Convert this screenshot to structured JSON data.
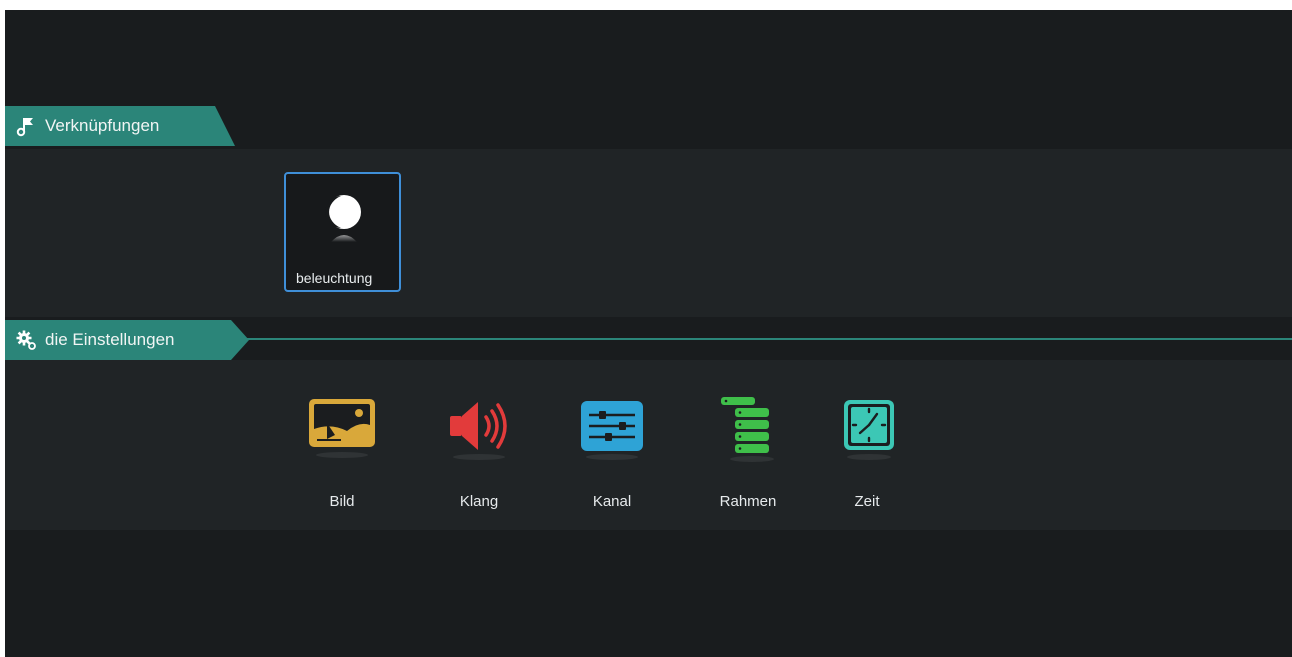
{
  "sections": {
    "shortcuts": {
      "title": "Verknüpfungen",
      "icon": "flag-music-icon"
    },
    "settings": {
      "title": "die Einstellungen",
      "icon": "gears-icon"
    }
  },
  "shortcuts": [
    {
      "label": "beleuchtung",
      "icon": "moon-icon"
    }
  ],
  "settings_items": [
    {
      "label": "Bild",
      "icon": "picture-icon",
      "color": "#d9a83a"
    },
    {
      "label": "Klang",
      "icon": "speaker-icon",
      "color": "#e23b3b"
    },
    {
      "label": "Kanal",
      "icon": "sliders-icon",
      "color": "#2ea3d6"
    },
    {
      "label": "Rahmen",
      "icon": "server-stack-icon",
      "color": "#3fbf4a"
    },
    {
      "label": "Zeit",
      "icon": "clock-icon",
      "color": "#3cc7b5"
    }
  ],
  "colors": {
    "accent": "#2b8579",
    "focus": "#3f8fd8",
    "background": "#191c1e"
  }
}
